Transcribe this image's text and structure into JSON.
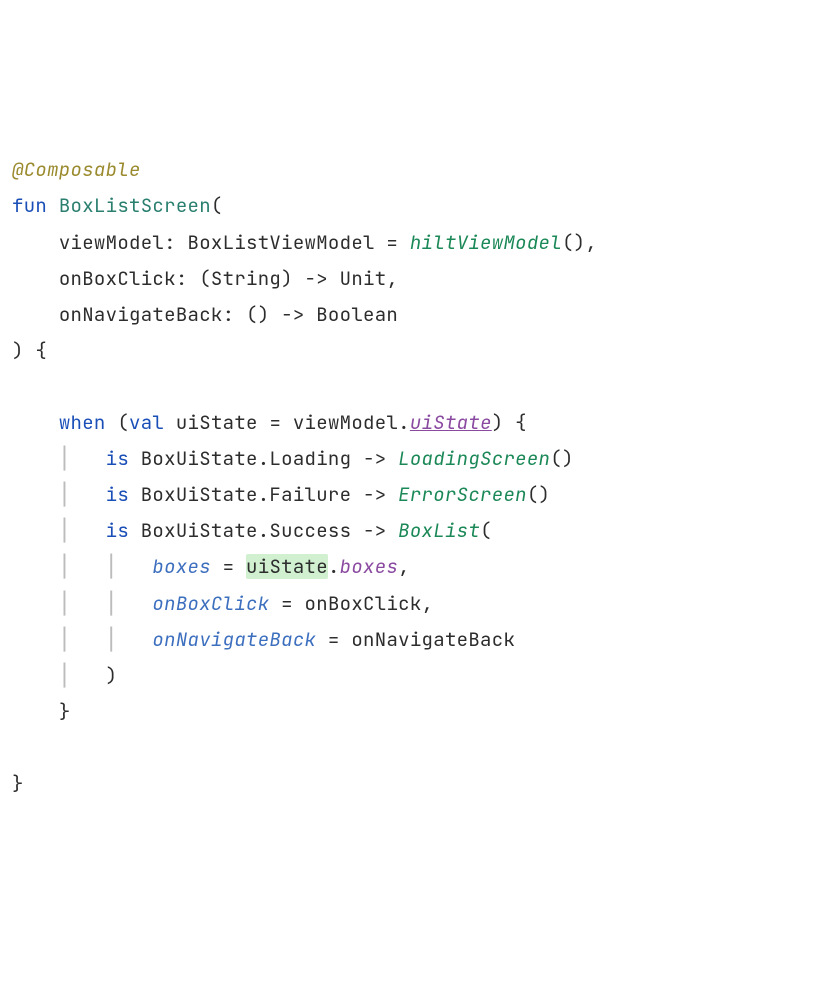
{
  "code": {
    "annotation": "@Composable",
    "fun_kw": "fun",
    "fun_name": "BoxListScreen",
    "paren_open": "(",
    "param1_name": "viewModel",
    "param1_type": "BoxListViewModel",
    "param1_eq": " = ",
    "param1_default": "hiltViewModel",
    "param1_call": "()",
    "comma": ",",
    "param2_name": "onBoxClick",
    "param2_type": "(String) -> Unit",
    "param3_name": "onNavigateBack",
    "param3_type": "() -> Boolean",
    "paren_close_brace": ") {",
    "when_kw": "when",
    "val_kw": "val",
    "uiState_var": "uiState",
    "assign": " = ",
    "viewModel_ref": "viewModel",
    "dot": ".",
    "uiState_prop": "uiState",
    "when_open": ") {",
    "is_kw": "is",
    "state_loading": "BoxUiState.Loading",
    "arrow": "->",
    "loading_call": "LoadingScreen",
    "empty_parens": "()",
    "state_failure": "BoxUiState.Failure",
    "error_call": "ErrorScreen",
    "state_success": "BoxUiState.Success",
    "boxlist_call": "BoxList",
    "boxlist_open": "(",
    "arg_boxes": "boxes",
    "uiState_ref": "uiState",
    "boxes_member": "boxes",
    "arg_onBoxClick": "onBoxClick",
    "onBoxClick_val": "onBoxClick",
    "arg_onNavigateBack": "onNavigateBack",
    "onNavigateBack_val": "onNavigateBack",
    "close_paren": ")",
    "close_brace": "}"
  }
}
